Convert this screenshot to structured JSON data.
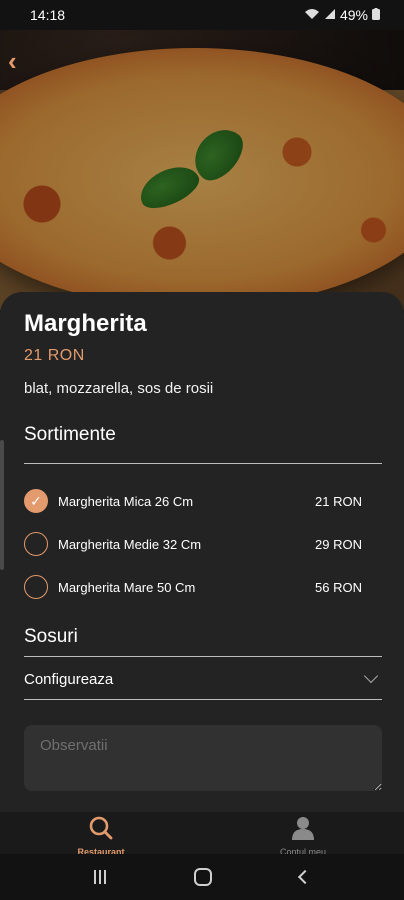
{
  "status": {
    "time": "14:18",
    "battery": "49%"
  },
  "product": {
    "title": "Margherita",
    "price": "21 RON",
    "description": "blat, mozzarella, sos de rosii"
  },
  "sortimente": {
    "title": "Sortimente",
    "options": [
      {
        "label": "Margherita Mica 26 Cm",
        "price": "21 RON",
        "checked": true
      },
      {
        "label": "Margherita Medie 32 Cm",
        "price": "29 RON",
        "checked": false
      },
      {
        "label": "Margherita Mare 50 Cm",
        "price": "56 RON",
        "checked": false
      }
    ]
  },
  "sosuri": {
    "title": "Sosuri",
    "select_label": "Configureaza"
  },
  "notes": {
    "placeholder": "Observatii"
  },
  "tabs": [
    {
      "label": "Restaurant",
      "icon": "search-icon",
      "active": true
    },
    {
      "label": "Contul meu",
      "icon": "user-icon",
      "active": false
    }
  ],
  "colors": {
    "accent": "#e39a6c",
    "sheet": "#232323"
  }
}
